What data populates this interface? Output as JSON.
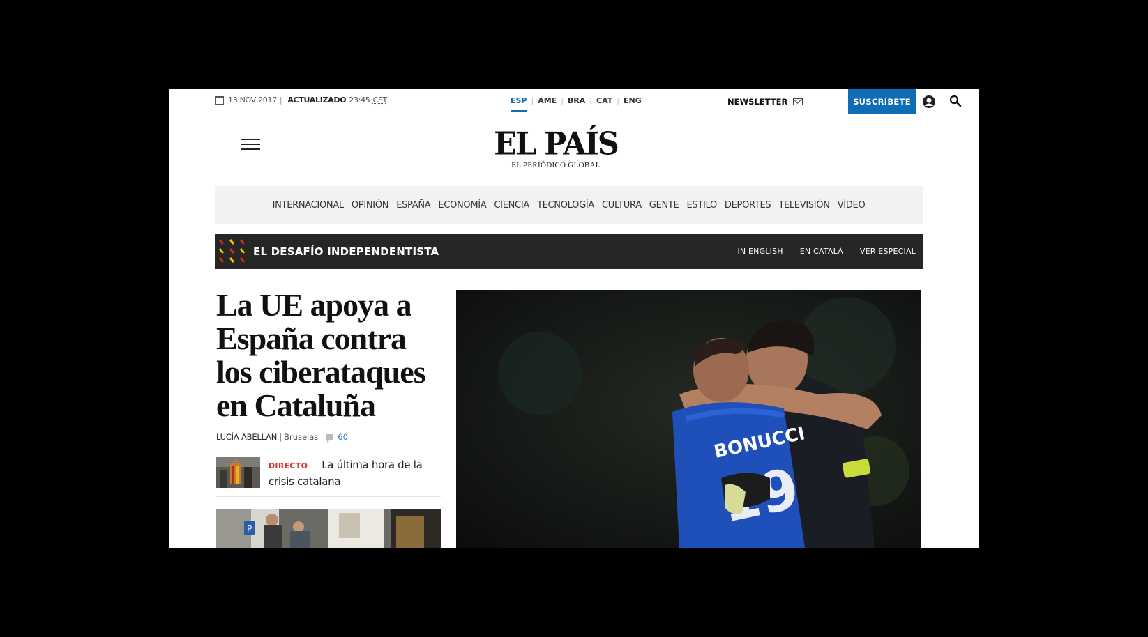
{
  "topbar": {
    "date": "13 NOV 2017",
    "updated_label": "ACTUALIZADO",
    "updated_time": "23:45",
    "timezone": "CET",
    "editions": [
      "ESP",
      "AME",
      "BRA",
      "CAT",
      "ENG"
    ],
    "active_edition": "ESP",
    "newsletter_label": "NEWSLETTER",
    "subscribe_label": "SUSCRÍBETE"
  },
  "masthead": {
    "logo": "EL PAÍS",
    "tagline": "EL PERIÓDICO GLOBAL"
  },
  "sections": [
    "INTERNACIONAL",
    "OPINIÓN",
    "ESPAÑA",
    "ECONOMÍA",
    "CIENCIA",
    "TECNOLOGÍA",
    "CULTURA",
    "GENTE",
    "ESTILO",
    "DEPORTES",
    "TELEVISIÓN",
    "VÍDEO"
  ],
  "special": {
    "title": "EL DESAFÍO INDEPENDENTISTA",
    "links": [
      "IN ENGLISH",
      "EN CATALÀ",
      "VER ESPECIAL"
    ]
  },
  "lead": {
    "headline": "La UE apoya a España contra los ciberataques en Cataluña",
    "author": "Lucía Abellán",
    "location": "Bruselas",
    "comments": "60"
  },
  "live": {
    "tag": "DIRECTO",
    "text": "La última hora de la crisis catalana"
  },
  "photo": {
    "jersey_name": "BONUCCI"
  },
  "colors": {
    "brand_blue": "#0f6db3",
    "live_red": "#d9322d",
    "special_bg": "#262626"
  }
}
